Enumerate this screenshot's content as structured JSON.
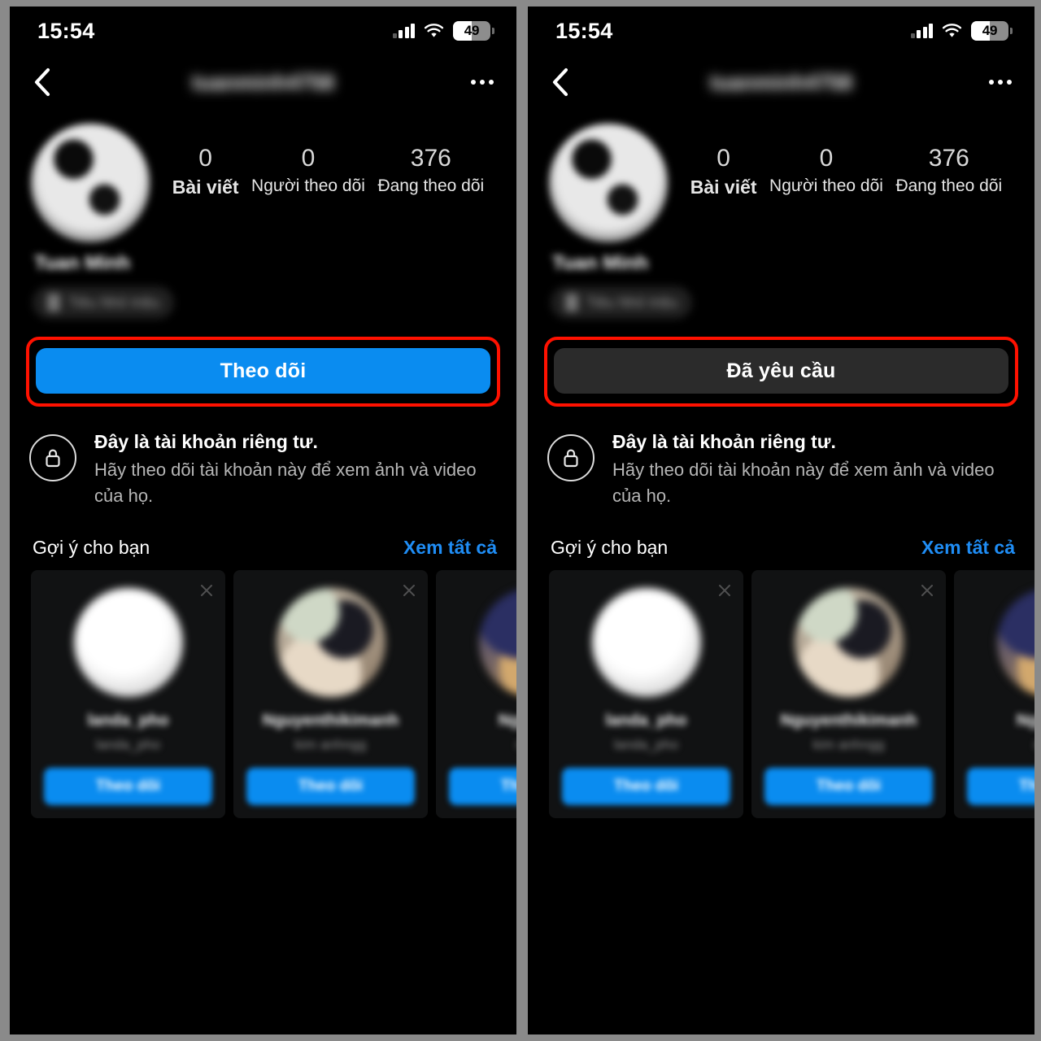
{
  "meta": {
    "app": "Instagram profile — private account follow request",
    "panel_count": 2
  },
  "status_bar": {
    "time": "15:54",
    "battery_level": "49",
    "signal_icon": "cellular-signal-icon",
    "wifi_icon": "wifi-icon",
    "battery_icon": "battery-icon"
  },
  "nav": {
    "back_icon": "back-chevron-icon",
    "title": "tuanminh4758",
    "more_icon": "more-options-icon"
  },
  "profile": {
    "avatar_label": "profile-avatar",
    "display_name": "Tuan Minh",
    "badge_text": "Tiêu Nhỏ triệu",
    "stats": [
      {
        "value": "0",
        "label": "Bài viết"
      },
      {
        "value": "0",
        "label": "Người theo dõi"
      },
      {
        "value": "376",
        "label": "Đang theo dõi"
      }
    ]
  },
  "panels": [
    {
      "action_button": {
        "label": "Theo dõi",
        "state": "follow",
        "color": "#0a8cf0",
        "highlighted": true
      }
    },
    {
      "action_button": {
        "label": "Đã yêu cầu",
        "state": "requested",
        "color": "#2b2b2b",
        "highlighted": true
      }
    }
  ],
  "private_notice": {
    "lock_icon": "lock-icon",
    "title": "Đây là tài khoản riêng tư.",
    "subtitle": "Hãy theo dõi tài khoản này để xem ảnh và video của họ."
  },
  "suggestions": {
    "title": "Gợi ý cho bạn",
    "see_all": "Xem tất cả",
    "cards": [
      {
        "name": "landa_pho",
        "subtitle": "landa_pho",
        "button": "Theo dõi",
        "close_icon": "close-icon"
      },
      {
        "name": "Nguyenthikimanh",
        "subtitle": "kim anhngg",
        "button": "Theo dõi",
        "close_icon": "close-icon"
      },
      {
        "name": "Nguyễn t",
        "subtitle": "ngtha",
        "button": "Theo dõi",
        "close_icon": "close-icon"
      }
    ]
  },
  "colors": {
    "accent_blue": "#0a8cf0",
    "link_blue": "#1f8df5",
    "highlight_red": "#ff1100",
    "panel_bg": "#000000",
    "card_bg": "#111213",
    "requested_gray": "#2b2b2b",
    "page_border_gray": "#8a8a8a"
  }
}
